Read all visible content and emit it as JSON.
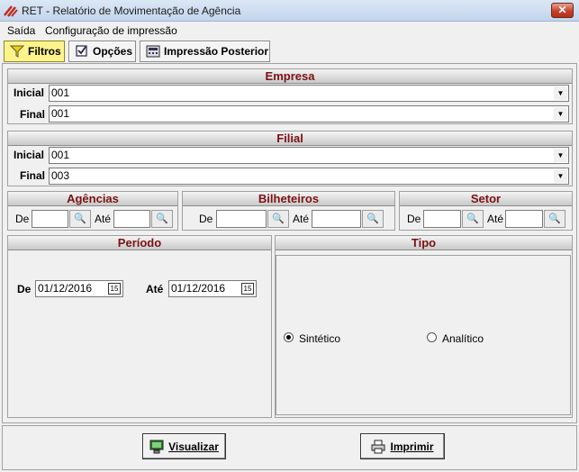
{
  "window": {
    "title": "RET - Relatório de Movimentação de Agência",
    "close": "✕"
  },
  "menu": [
    "Saída",
    "Configuração de impressão"
  ],
  "tabs": [
    {
      "label": "Filtros",
      "icon": "funnel-icon",
      "active": true
    },
    {
      "label": "Opções",
      "icon": "checkbox-icon"
    },
    {
      "label": "Impressão Posterior",
      "icon": "calculator-icon"
    }
  ],
  "empresa": {
    "header": "Empresa",
    "inicial_label": "Inicial",
    "final_label": "Final",
    "inicial": "001",
    "final": "001"
  },
  "filial": {
    "header": "Filial",
    "inicial_label": "Inicial",
    "final_label": "Final",
    "inicial": "001",
    "final": "003"
  },
  "agencias": {
    "header": "Agências",
    "de": "De",
    "ate": "Até"
  },
  "bilheteiros": {
    "header": "Bilheteiros",
    "de": "De",
    "ate": "Até"
  },
  "setor": {
    "header": "Setor",
    "de": "De",
    "ate": "Até"
  },
  "periodo": {
    "header": "Período",
    "de_label": "De",
    "ate_label": "Até",
    "de": "01/12/2016",
    "ate": "01/12/2016",
    "cal_glyph": "15"
  },
  "tipo": {
    "header": "Tipo",
    "options": [
      "Sintético",
      "Analítico"
    ],
    "selected": "Sintético"
  },
  "buttons": {
    "visualizar": "Visualizar",
    "imprimir": "Imprimir"
  },
  "colors": {
    "section_title": "#7b1113",
    "active_tab": "#fdf38a"
  },
  "bino_glyph": "🔍"
}
